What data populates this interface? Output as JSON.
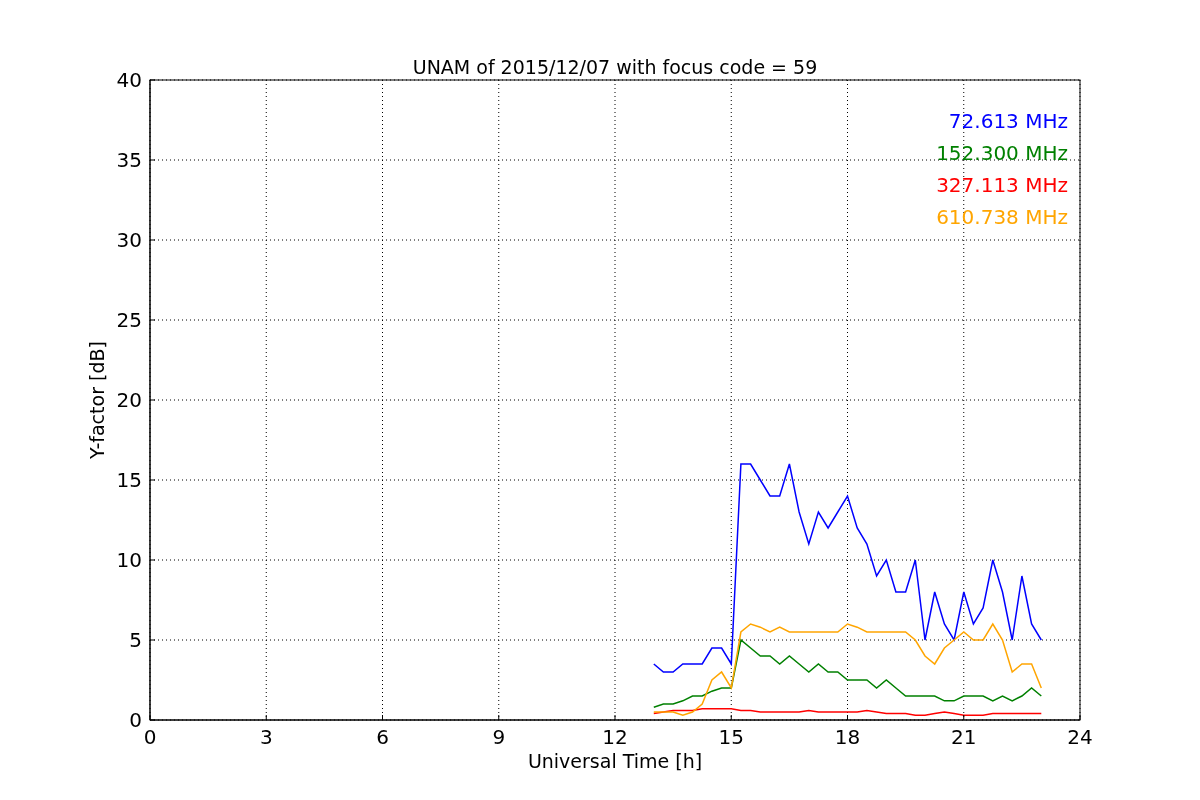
{
  "figure": {
    "chart_data": {
      "type": "line",
      "title": "UNAM of 2015/12/07 with focus code = 59",
      "xlabel": "Universal Time [h]",
      "ylabel": "Y-factor [dB]",
      "x": [
        13,
        13.25,
        13.5,
        13.75,
        14,
        14.25,
        14.5,
        14.75,
        15,
        15.25,
        15.5,
        15.75,
        16,
        16.25,
        16.5,
        16.75,
        17,
        17.25,
        17.5,
        17.75,
        18,
        18.25,
        18.5,
        18.75,
        19,
        19.25,
        19.5,
        19.75,
        20,
        20.25,
        20.5,
        20.75,
        21,
        21.25,
        21.5,
        21.75,
        22,
        22.25,
        22.5,
        22.75,
        23
      ],
      "series": [
        {
          "name": "72.613 MHz",
          "color": "#0000ff",
          "values": [
            3.5,
            3,
            3,
            3.5,
            3.5,
            3.5,
            4.5,
            4.5,
            3.5,
            16,
            16,
            15,
            14,
            14,
            16,
            13,
            11,
            13,
            12,
            13,
            14,
            12,
            11,
            9,
            10,
            8,
            8,
            10,
            5,
            8,
            6,
            5,
            8,
            6,
            7,
            10,
            8,
            5,
            9,
            6,
            5
          ]
        },
        {
          "name": "152.300 MHz",
          "color": "#008000",
          "values": [
            0.8,
            1,
            1,
            1.2,
            1.5,
            1.5,
            1.8,
            2,
            2,
            5,
            4.5,
            4,
            4,
            3.5,
            4,
            3.5,
            3,
            3.5,
            3,
            3,
            2.5,
            2.5,
            2.5,
            2,
            2.5,
            2,
            1.5,
            1.5,
            1.5,
            1.5,
            1.2,
            1.2,
            1.5,
            1.5,
            1.5,
            1.2,
            1.5,
            1.2,
            1.5,
            2,
            1.5
          ]
        },
        {
          "name": "327.113 MHz",
          "color": "#ff0000",
          "values": [
            0.4,
            0.5,
            0.6,
            0.6,
            0.6,
            0.7,
            0.7,
            0.7,
            0.7,
            0.6,
            0.6,
            0.5,
            0.5,
            0.5,
            0.5,
            0.5,
            0.6,
            0.5,
            0.5,
            0.5,
            0.5,
            0.5,
            0.6,
            0.5,
            0.4,
            0.4,
            0.4,
            0.3,
            0.3,
            0.4,
            0.5,
            0.4,
            0.3,
            0.3,
            0.3,
            0.4,
            0.4,
            0.4,
            0.4,
            0.4,
            0.4
          ]
        },
        {
          "name": "610.738 MHz",
          "color": "#ffa500",
          "values": [
            0.5,
            0.5,
            0.5,
            0.3,
            0.5,
            1,
            2.5,
            3,
            2,
            5.5,
            6,
            5.8,
            5.5,
            5.8,
            5.5,
            5.5,
            5.5,
            5.5,
            5.5,
            5.5,
            6,
            5.8,
            5.5,
            5.5,
            5.5,
            5.5,
            5.5,
            5,
            4,
            3.5,
            4.5,
            5,
            5.5,
            5,
            5,
            6,
            5,
            3,
            3.5,
            3.5,
            2
          ]
        }
      ],
      "xlim": [
        0,
        24
      ],
      "ylim": [
        0,
        40
      ],
      "xticks": [
        0,
        3,
        6,
        9,
        12,
        15,
        18,
        21,
        24
      ],
      "yticks": [
        0,
        5,
        10,
        15,
        20,
        25,
        30,
        35,
        40
      ],
      "grid": true
    }
  }
}
